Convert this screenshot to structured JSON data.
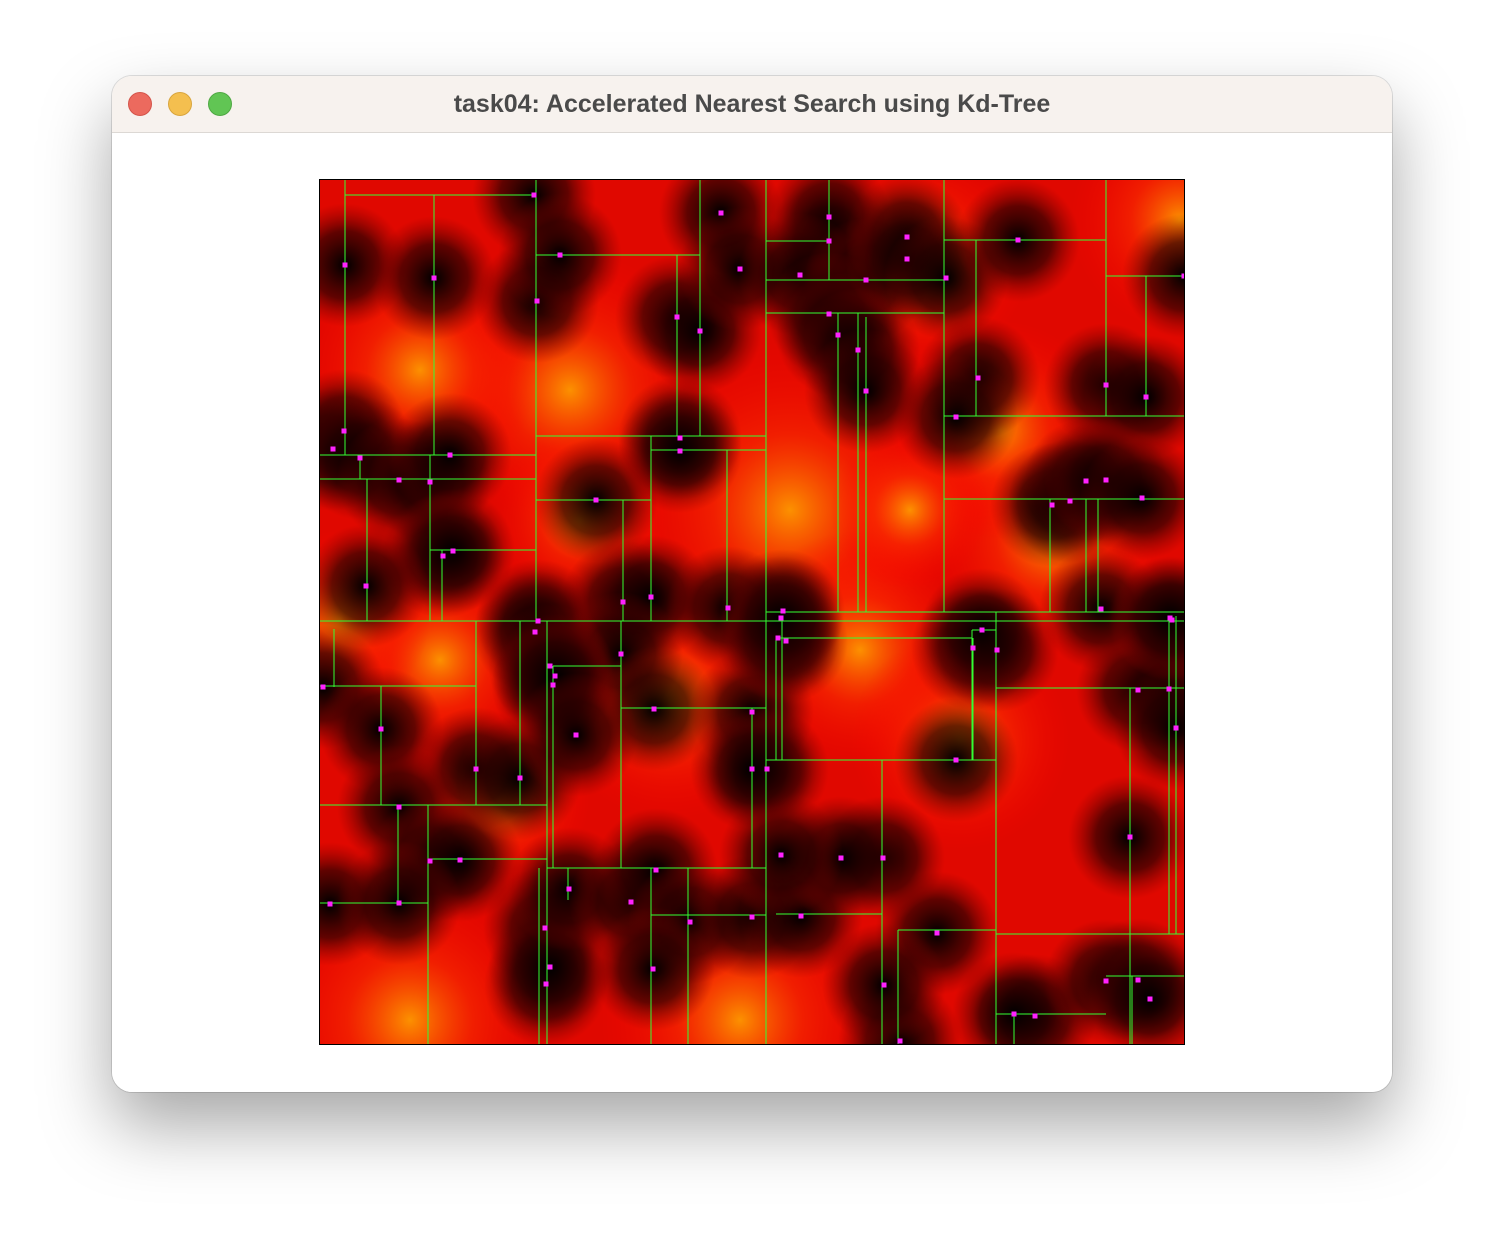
{
  "window": {
    "title": "task04: Accelerated Nearest Search using Kd-Tree"
  },
  "controls": {
    "close_icon": "close-icon",
    "minimize_icon": "minimize-icon",
    "zoom_icon": "zoom-icon"
  },
  "visualization": {
    "background_gradient": [
      "#000000",
      "#ff0000",
      "#ffa000"
    ],
    "split_line_color": "#33ff33",
    "point_color": "#ff22ff"
  }
}
